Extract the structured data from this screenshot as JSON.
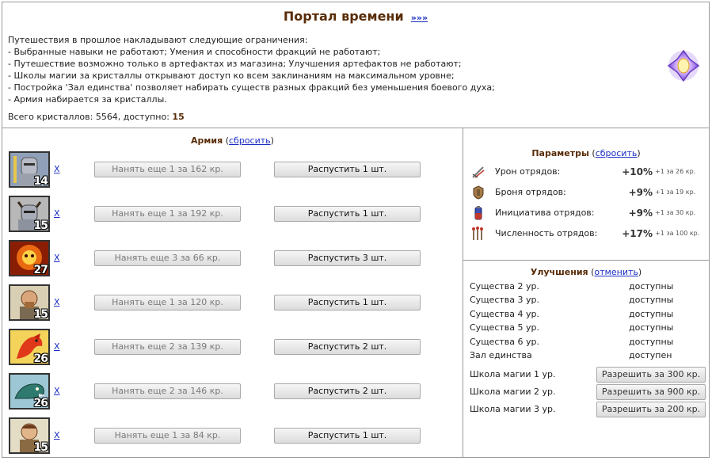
{
  "title": "Портал времени",
  "title_link": "»»»",
  "intro_lines": [
    "Путешествия в прошлое накладывают следующие ограничения:",
    "- Выбранные навыки не работают; Умения и способности фракций не работают;",
    "- Путешествие возможно только в артефактах из магазина; Улучшения артефактов не работают;",
    "- Школы магии за кристаллы открывают доступ ко всем заклинаниям на максимальном уровне;",
    "- Постройка 'Зал единства' позволяет набирать существ разных фракций без уменьшения боевого духа;",
    "- Армия набирается за кристаллы."
  ],
  "crystals": {
    "label": "Всего кристаллов: 5564, доступно: ",
    "available": "15"
  },
  "army": {
    "title": "Армия",
    "reset": "сбросить",
    "rows": [
      {
        "count": "14",
        "x": "X",
        "hire": "Нанять еще 1 за 162 кр.",
        "dismiss": "Распустить 1 шт."
      },
      {
        "count": "15",
        "x": "X",
        "hire": "Нанять еще 1 за 192 кр.",
        "dismiss": "Распустить 1 шт."
      },
      {
        "count": "27",
        "x": "X",
        "hire": "Нанять еще 3 за 66 кр.",
        "dismiss": "Распустить 3 шт."
      },
      {
        "count": "15",
        "x": "X",
        "hire": "Нанять еще 1 за 120 кр.",
        "dismiss": "Распустить 1 шт."
      },
      {
        "count": "26",
        "x": "X",
        "hire": "Нанять еще 2 за 139 кр.",
        "dismiss": "Распустить 2 шт."
      },
      {
        "count": "26",
        "x": "X",
        "hire": "Нанять еще 2 за 146 кр.",
        "dismiss": "Распустить 2 шт."
      },
      {
        "count": "15",
        "x": "X",
        "hire": "Нанять еще 1 за 84 кр.",
        "dismiss": "Распустить 1 шт."
      }
    ]
  },
  "params": {
    "title": "Параметры",
    "reset": "сбросить",
    "rows": [
      {
        "icon": "damage-icon",
        "label": "Урон отрядов:",
        "value": "+10%",
        "cost": "+1 за 26 кр."
      },
      {
        "icon": "armor-icon",
        "label": "Броня отрядов:",
        "value": "+9%",
        "cost": "+1 за 19 кр."
      },
      {
        "icon": "initiative-icon",
        "label": "Инициатива отрядов:",
        "value": "+9%",
        "cost": "+1 за 30 кр."
      },
      {
        "icon": "numbers-icon",
        "label": "Численность отрядов:",
        "value": "+17%",
        "cost": "+1 за 100 кр."
      }
    ]
  },
  "upgrades": {
    "title": "Улучшения",
    "cancel": "отменить",
    "rows": [
      {
        "label": "Существа 2 ур.",
        "status": "доступны"
      },
      {
        "label": "Существа 3 ур.",
        "status": "доступны"
      },
      {
        "label": "Существа 4 ур.",
        "status": "доступны"
      },
      {
        "label": "Существа 5 ур.",
        "status": "доступны"
      },
      {
        "label": "Существа 6 ур.",
        "status": "доступны"
      },
      {
        "label": "Зал единства",
        "status": "доступен"
      }
    ],
    "schools": [
      {
        "label": "Школа магии 1 ур.",
        "button": "Разрешить за 300 кр."
      },
      {
        "label": "Школа магии 2 ур.",
        "button": "Разрешить за 900 кр."
      },
      {
        "label": "Школа магии 3 ур.",
        "button": "Разрешить за 200 кр."
      }
    ]
  },
  "colors": {
    "title": "#592c08",
    "link": "#1b2ec4",
    "border": "#9a9a9a"
  }
}
